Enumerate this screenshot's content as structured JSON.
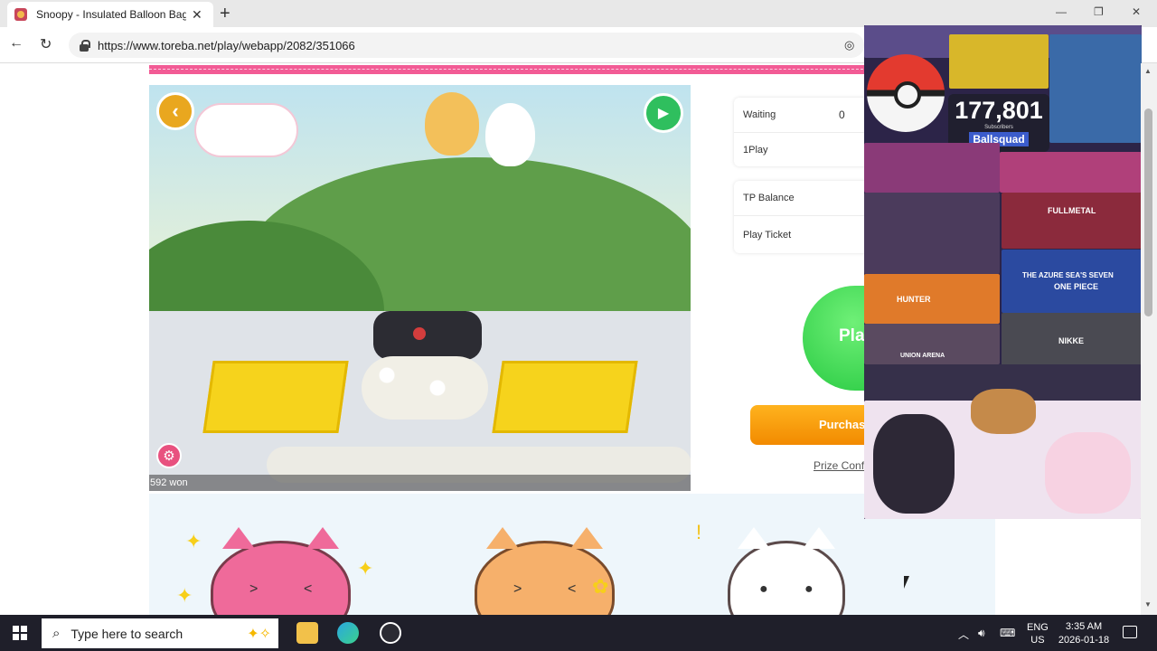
{
  "browser": {
    "tab_title": "Snoopy - Insulated Balloon Bag S",
    "new_tab": "+",
    "url": "https://www.toreba.net/play/webapp/2082/351066"
  },
  "game": {
    "won_label": "592 won",
    "waiting_label": "Waiting",
    "waiting_count": "0",
    "plays_label": "1Play",
    "tp_balance_label": "TP Balance",
    "play_ticket_label": "Play Ticket",
    "play_button": "Pla",
    "purchase_button": "Purchas",
    "prize_link": "Prize Confi"
  },
  "overlay": {
    "subscriber_count": "177,801",
    "subscriber_label": "Subscribers",
    "channel_name": "Ballsquad",
    "box_labels": [
      "HUNTER",
      "FULLMETAL",
      "THE AZURE SEA'S SEVEN",
      "ONE PIECE",
      "NIKKE",
      "UNION ARENA"
    ]
  },
  "taskbar": {
    "search_placeholder": "Type here to search",
    "lang_top": "ENG",
    "lang_bottom": "US",
    "time": "3:35 AM",
    "date": "2026-01-18"
  },
  "colors": {
    "pink_strip": "#f25b95",
    "play_green": "#1cc339",
    "purchase_orange": "#f28a00",
    "taskbar": "#1f1f2a"
  },
  "icons": [
    "back-arrow-icon",
    "reload-icon",
    "lock-icon",
    "eye-off-icon",
    "camera-icon",
    "gear-icon",
    "search-icon",
    "windows-start-icon",
    "file-explorer-icon",
    "edge-icon",
    "obs-icon",
    "chevron-up-icon",
    "speaker-icon",
    "keyboard-icon",
    "notification-icon"
  ]
}
